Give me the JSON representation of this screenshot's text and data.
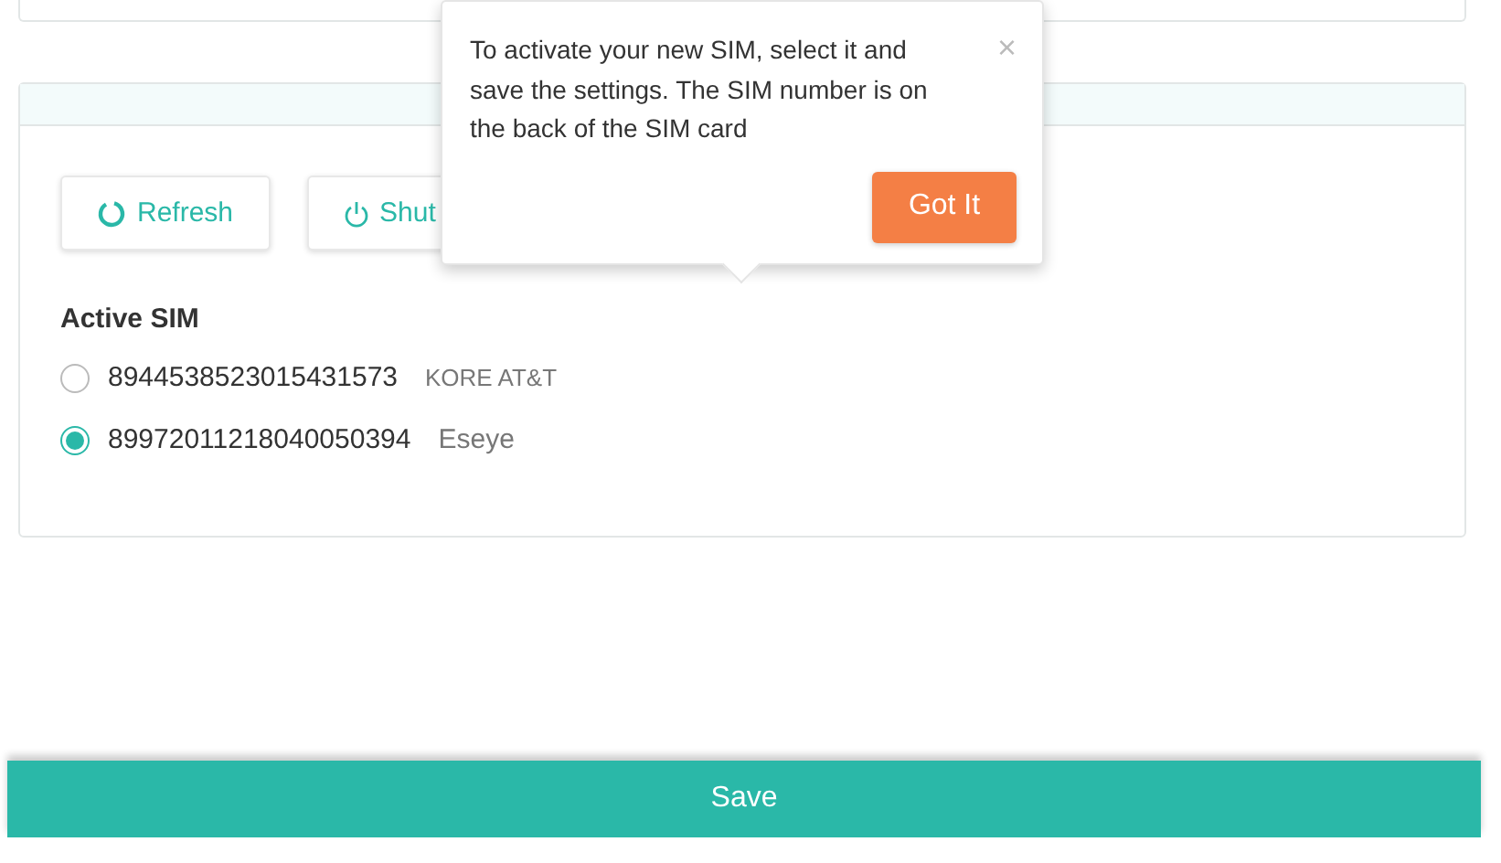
{
  "toolbar": {
    "buttons": [
      {
        "label": "Refresh",
        "kind": "refresh"
      },
      {
        "label": "Shut",
        "kind": "power"
      }
    ]
  },
  "active_sim": {
    "label": "Active SIM",
    "options": [
      {
        "number": "8944538523015431573",
        "carrier": "KORE AT&T",
        "selected": false
      },
      {
        "number": "89972011218040050394",
        "carrier": "Eseye",
        "selected": true
      }
    ]
  },
  "tooltip": {
    "text": "To activate your new SIM, select it and save the settings. The SIM number is on the back of the SIM card",
    "close": "×",
    "button": "Got It"
  },
  "save_button": "Save"
}
